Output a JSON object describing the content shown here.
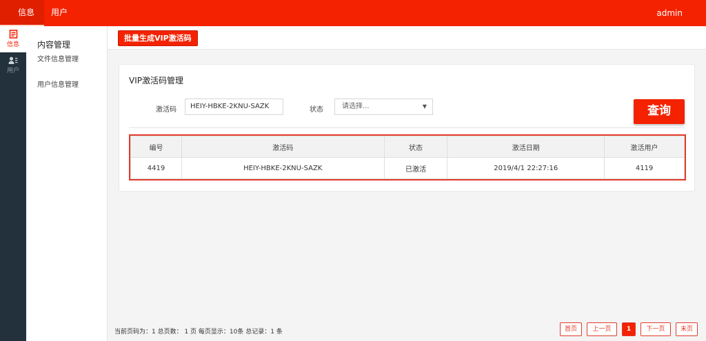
{
  "topbar": {
    "nav": [
      {
        "label": "信息"
      },
      {
        "label": "用户"
      }
    ],
    "user": "admin"
  },
  "iconbar": {
    "items": [
      {
        "label": "信息",
        "icon": "document-icon"
      },
      {
        "label": "用户",
        "icon": "user-list-icon"
      }
    ]
  },
  "sidemenu": {
    "group_title": "内容管理",
    "items": [
      {
        "label": "文件信息管理"
      },
      {
        "label": "用户信息管理"
      }
    ]
  },
  "toolbar": {
    "generate_label": "批量生成VIP激活码"
  },
  "panel": {
    "title": "VIP激活码管理",
    "code_label": "激活码",
    "code_value": "HEIY-HBKE-2KNU-SAZK",
    "status_label": "状态",
    "status_placeholder": "请选择...",
    "query_label": "查询"
  },
  "table": {
    "headers": [
      "编号",
      "激活码",
      "状态",
      "激活日期",
      "激活用户"
    ],
    "rows": [
      [
        "4419",
        "HEIY-HBKE-2KNU-SAZK",
        "已激活",
        "2019/4/1 22:27:16",
        "4119"
      ]
    ]
  },
  "pager": {
    "info": "当前页码为：1 总页数： 1 页 每页显示：10条 总记录：1 条",
    "first": "首页",
    "prev": "上一页",
    "current": "1",
    "next": "下一页",
    "last": "末页"
  },
  "colors": {
    "brand": "#f42200",
    "sidebar_dark": "#22313b",
    "table_border": "#e03b2a"
  }
}
